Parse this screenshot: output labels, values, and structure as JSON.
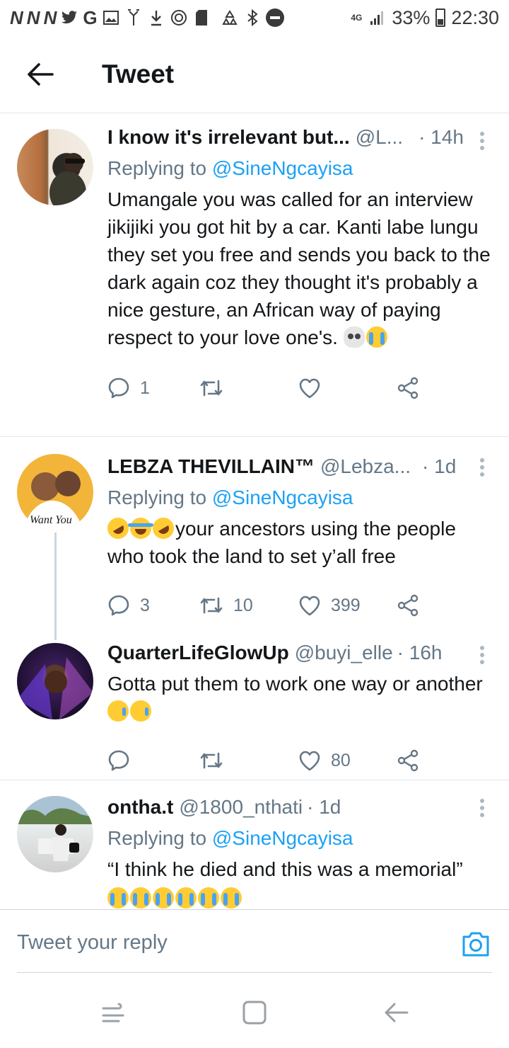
{
  "status_bar": {
    "left_icons": [
      "N",
      "N",
      "N",
      "twitter-icon",
      "G",
      "gallery-icon",
      "antenna-icon",
      "download-icon",
      "instagram-icon",
      "sd-card-icon",
      "recycle-icon",
      "bluetooth-icon",
      "dnd-icon"
    ],
    "network": "4G",
    "battery": "33%",
    "time": "22:30"
  },
  "header": {
    "title": "Tweet"
  },
  "tweets": [
    {
      "name": "I know it's irrelevant but...",
      "handle": "@L...",
      "time": "· 14h",
      "replying_prefix": "Replying to",
      "replying_to": "@SineNgcayisa",
      "text": "Umangale you was called for an interview jikijiki you got hit by a car. Kanti labe lungu they set you free and sends you back to the dark again coz they thought it's probably a nice gesture, an African way of paying respect to your love one's.",
      "emojis": [
        "skull",
        "cry"
      ],
      "replies": "1",
      "retweets": "",
      "likes": ""
    },
    {
      "name": "LEBZA THEVILLAIN™",
      "handle": "@Lebza...",
      "time": "· 1d",
      "replying_prefix": "Replying to",
      "replying_to": "@SineNgcayisa",
      "text": "your ancestors using the people who took the land to set y’all free",
      "emojis": [
        "rofl",
        "joy",
        "rofl"
      ],
      "replies": "3",
      "retweets": "10",
      "likes": "399"
    },
    {
      "name": "QuarterLifeGlowUp",
      "handle": "@buyi_elle",
      "time": "· 16h",
      "text": "Gotta put them to work one way or another",
      "emojis": [
        "sad",
        "sad"
      ],
      "replies": "",
      "retweets": "",
      "likes": "80"
    },
    {
      "name": "ontha.t",
      "handle": "@1800_nthati",
      "time": "· 1d",
      "replying_prefix": "Replying to",
      "replying_to": "@SineNgcayisa",
      "text": "“I think he died and this was a memorial”",
      "emojis": [
        "cry",
        "cry",
        "cry",
        "cry",
        "cry",
        "cry"
      ]
    }
  ],
  "composer": {
    "placeholder": "Tweet your reply"
  },
  "colors": {
    "accent": "#1da1f2",
    "secondary_text": "#657786",
    "divider": "#e1e8ed"
  }
}
